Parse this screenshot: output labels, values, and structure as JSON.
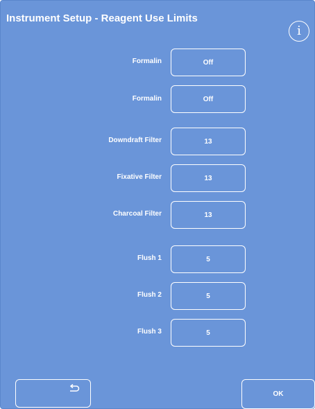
{
  "header": {
    "title": "Instrument Setup - Reagent Use Limits",
    "info_glyph": "i",
    "info_icon": "info-circle-icon"
  },
  "rows": [
    {
      "label": "Formalin",
      "value": "Off"
    },
    {
      "label": "Formalin",
      "value": "Off"
    },
    {
      "label": "Downdraft Filter",
      "value": "13"
    },
    {
      "label": "Fixative Filter",
      "value": "13"
    },
    {
      "label": "Charcoal Filter",
      "value": "13"
    },
    {
      "label": "Flush 1",
      "value": "5"
    },
    {
      "label": "Flush 2",
      "value": "5"
    },
    {
      "label": "Flush 3",
      "value": "5"
    }
  ],
  "footer": {
    "back_icon": "return-arrow-icon",
    "ok_label": "OK"
  },
  "colors": {
    "background": "#6a95d9",
    "foreground": "#ffffff"
  }
}
